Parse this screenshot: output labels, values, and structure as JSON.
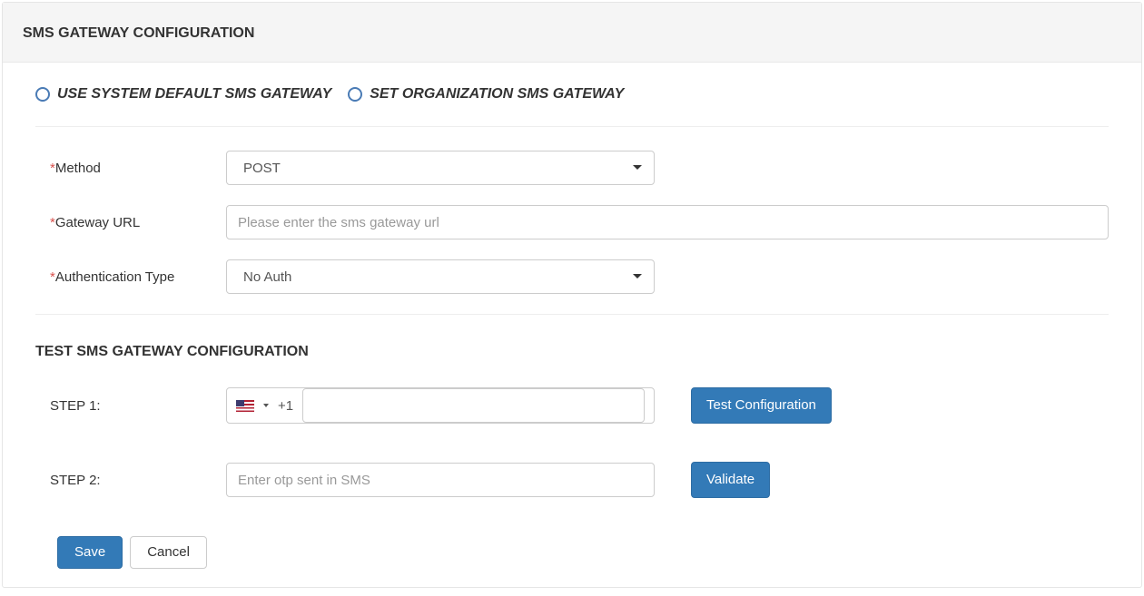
{
  "header": {
    "title": "SMS GATEWAY CONFIGURATION"
  },
  "radios": {
    "use_default": "USE SYSTEM DEFAULT SMS GATEWAY",
    "set_org": "SET ORGANIZATION SMS GATEWAY"
  },
  "form": {
    "method_label": "Method",
    "method_value": "POST",
    "gateway_url_label": "Gateway URL",
    "gateway_url_placeholder": "Please enter the sms gateway url",
    "auth_type_label": "Authentication Type",
    "auth_type_value": "No Auth"
  },
  "test": {
    "heading": "TEST SMS GATEWAY CONFIGURATION",
    "step1_label": "STEP 1:",
    "dial_code": "+1",
    "test_btn": "Test Configuration",
    "step2_label": "STEP 2:",
    "otp_placeholder": "Enter otp sent in SMS",
    "validate_btn": "Validate"
  },
  "footer": {
    "save": "Save",
    "cancel": "Cancel"
  }
}
